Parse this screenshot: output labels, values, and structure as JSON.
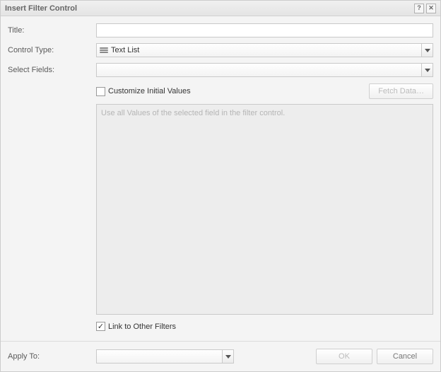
{
  "dialog": {
    "title": "Insert Filter Control"
  },
  "labels": {
    "title": "Title:",
    "control_type": "Control Type:",
    "select_fields": "Select Fields:",
    "customize": "Customize Initial Values",
    "fetch": "Fetch Data…",
    "placeholder": "Use all Values of the selected field in the filter control.",
    "link_filters": "Link to Other Filters",
    "apply_to": "Apply To:",
    "ok": "OK",
    "cancel": "Cancel"
  },
  "fields": {
    "title_value": "",
    "control_type_value": "Text List",
    "select_fields_value": "",
    "apply_to_value": "",
    "customize_checked": false,
    "link_filters_checked": true
  }
}
